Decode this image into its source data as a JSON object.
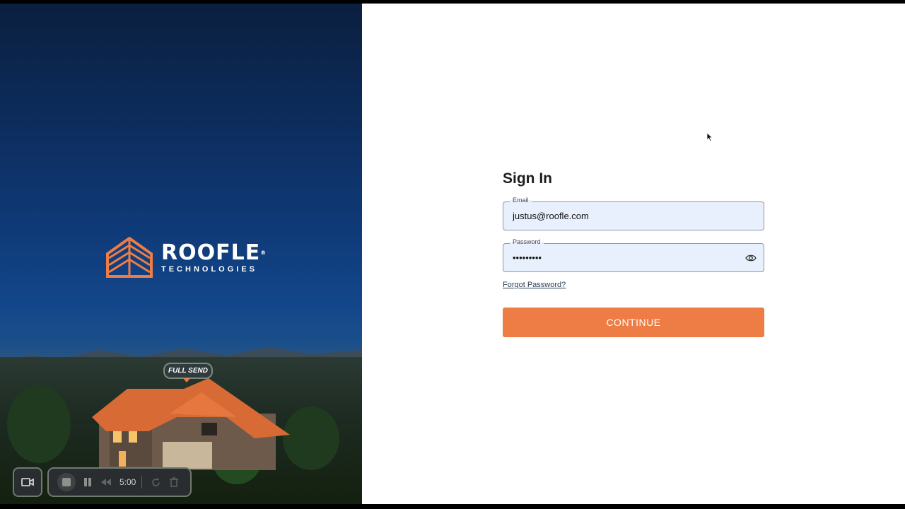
{
  "brand": {
    "name": "ROOFLE",
    "subtitle": "TECHNOLOGIES",
    "reg_mark": "®"
  },
  "hero": {
    "pin_label": "FULL SEND"
  },
  "recorder": {
    "time": "5:00"
  },
  "form": {
    "title": "Sign In",
    "email": {
      "label": "Email",
      "value": "justus@roofle.com"
    },
    "password": {
      "label": "Password",
      "value": "•••••••••"
    },
    "forgot_label": "Forgot Password?",
    "continue_label": "CONTINUE"
  },
  "colors": {
    "accent": "#ee7d45",
    "field_bg": "#e8f0fe",
    "hero_sky": "#0f3a78"
  },
  "icons": [
    "roofle-logo-icon",
    "eye-icon",
    "camera-icon",
    "stop-icon",
    "pause-icon",
    "rewind-icon",
    "restart-icon",
    "trash-icon",
    "mouse-cursor-icon"
  ]
}
